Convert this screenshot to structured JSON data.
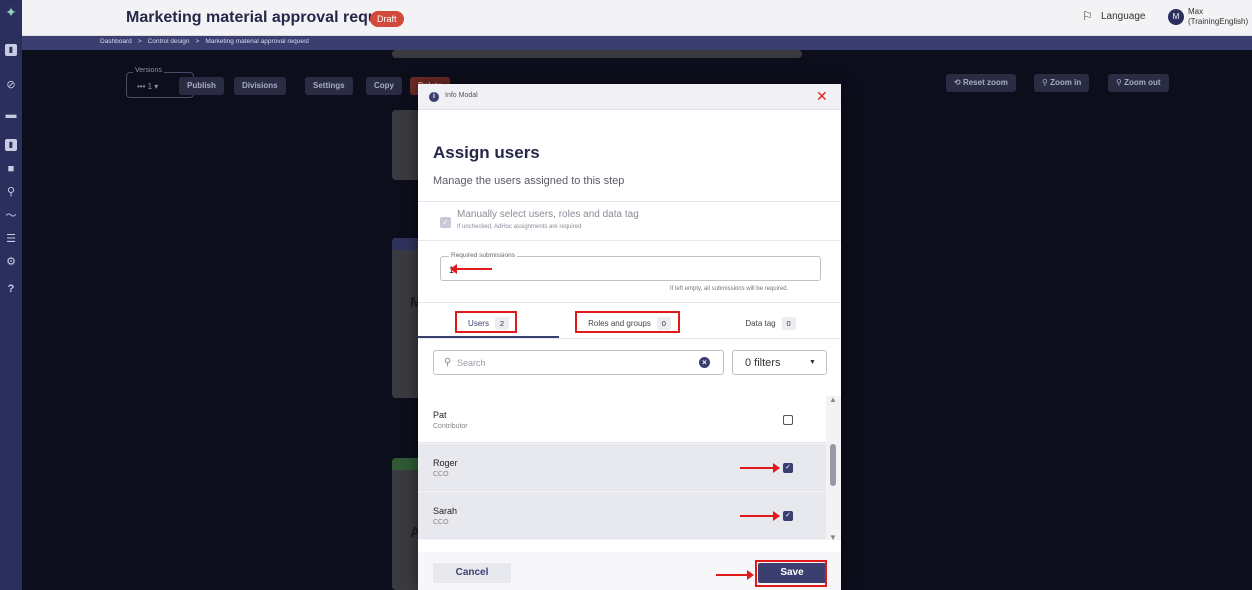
{
  "header": {
    "title": "Marketing material approval request",
    "status_badge": "Draft",
    "language_label": "Language",
    "avatar_initial": "M",
    "user_name": "Max (TrainingEnglish)"
  },
  "breadcrumb": {
    "items": [
      "Dashboard",
      "Control design",
      "Marketing material approval request"
    ],
    "separator": ">"
  },
  "toolbar": {
    "versions_label": "Versions",
    "versions_value": "1",
    "publish": "Publish",
    "divisions": "Divisions",
    "settings": "Settings",
    "copy": "Copy",
    "delete": "Delete",
    "reset_zoom": "Reset zoom",
    "zoom_in": "Zoom in",
    "zoom_out": "Zoom out"
  },
  "modal": {
    "header_label": "Info Modal",
    "title": "Assign users",
    "subtitle": "Manage the users assigned to this step",
    "manual_select_label": "Manually select users, roles and data tag",
    "manual_select_hint": "If unchecked, AdHoc assignments are required",
    "required_submissions_label": "Required submissions",
    "required_submissions_value": "1",
    "required_submissions_hint": "If left empty, all submissions will be required.",
    "tabs": [
      {
        "label": "Users",
        "count": "2"
      },
      {
        "label": "Roles and groups",
        "count": "0"
      },
      {
        "label": "Data tag",
        "count": "0"
      }
    ],
    "search_placeholder": "Search",
    "filters_value": "0 filters",
    "users": [
      {
        "name": "Pat",
        "role": "Contributor",
        "checked": false
      },
      {
        "name": "Roger",
        "role": "CCO",
        "checked": true
      },
      {
        "name": "Sarah",
        "role": "CCO",
        "checked": true
      }
    ],
    "cancel": "Cancel",
    "save": "Save"
  },
  "colors": {
    "primary": "#3b3f70",
    "rail": "#2b2f5e",
    "badge": "#d24a3a",
    "annotation": "#e01a1a"
  }
}
